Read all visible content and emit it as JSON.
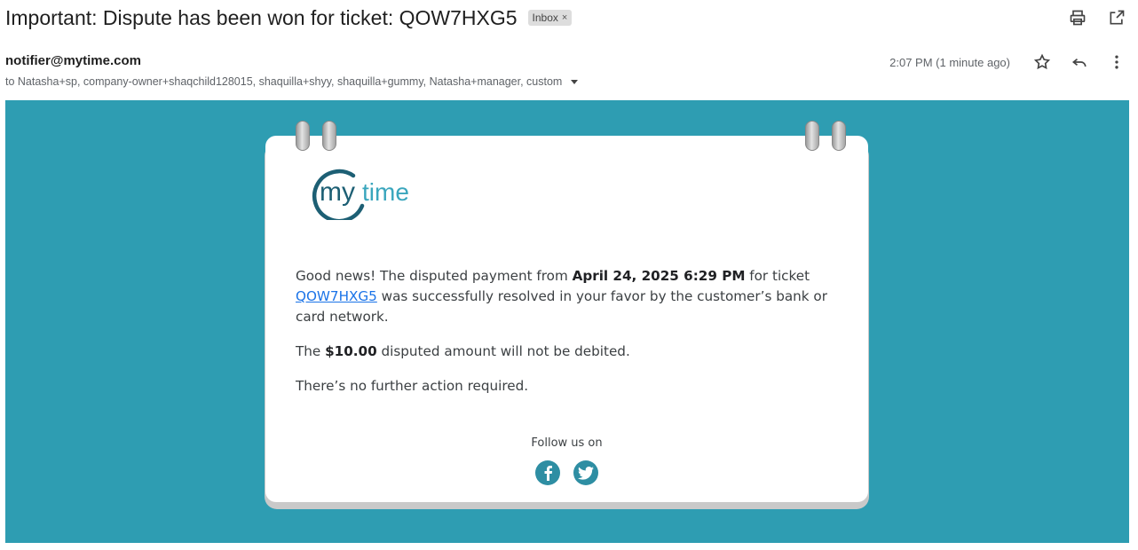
{
  "email": {
    "subject": "Important: Dispute has been won for ticket: QOW7HXG5",
    "label": "Inbox",
    "sender": "notifier@mytime.com",
    "recipients": "to Natasha+sp, company-owner+shaqchild128015, shaquilla+shyy, shaquilla+gummy, Natasha+manager, custom",
    "time": "2:07 PM (1 minute ago)"
  },
  "icons": {
    "print": "print-icon",
    "open_new_window": "open-in-new-icon",
    "star": "star-icon",
    "reply": "reply-icon",
    "more": "more-vert-icon"
  },
  "body": {
    "logo_text": "mytime",
    "p1_a": "Good news! The disputed payment from ",
    "p1_date": "April 24, 2025 6:29 PM",
    "p1_b": " for ticket ",
    "p1_ticket": "QOW7HXG5",
    "p1_c": " was successfully resolved in your favor by the customer’s bank or card network.",
    "p2_a": "The ",
    "p2_amount": "$10.00",
    "p2_b": " disputed amount will not be debited.",
    "p3": "There’s no further action required.",
    "follow": "Follow us on"
  },
  "colors": {
    "banner": "#2e9db2",
    "brand_dark": "#1d5f74",
    "brand_light": "#3aa6bd",
    "link": "#1a73e8"
  }
}
